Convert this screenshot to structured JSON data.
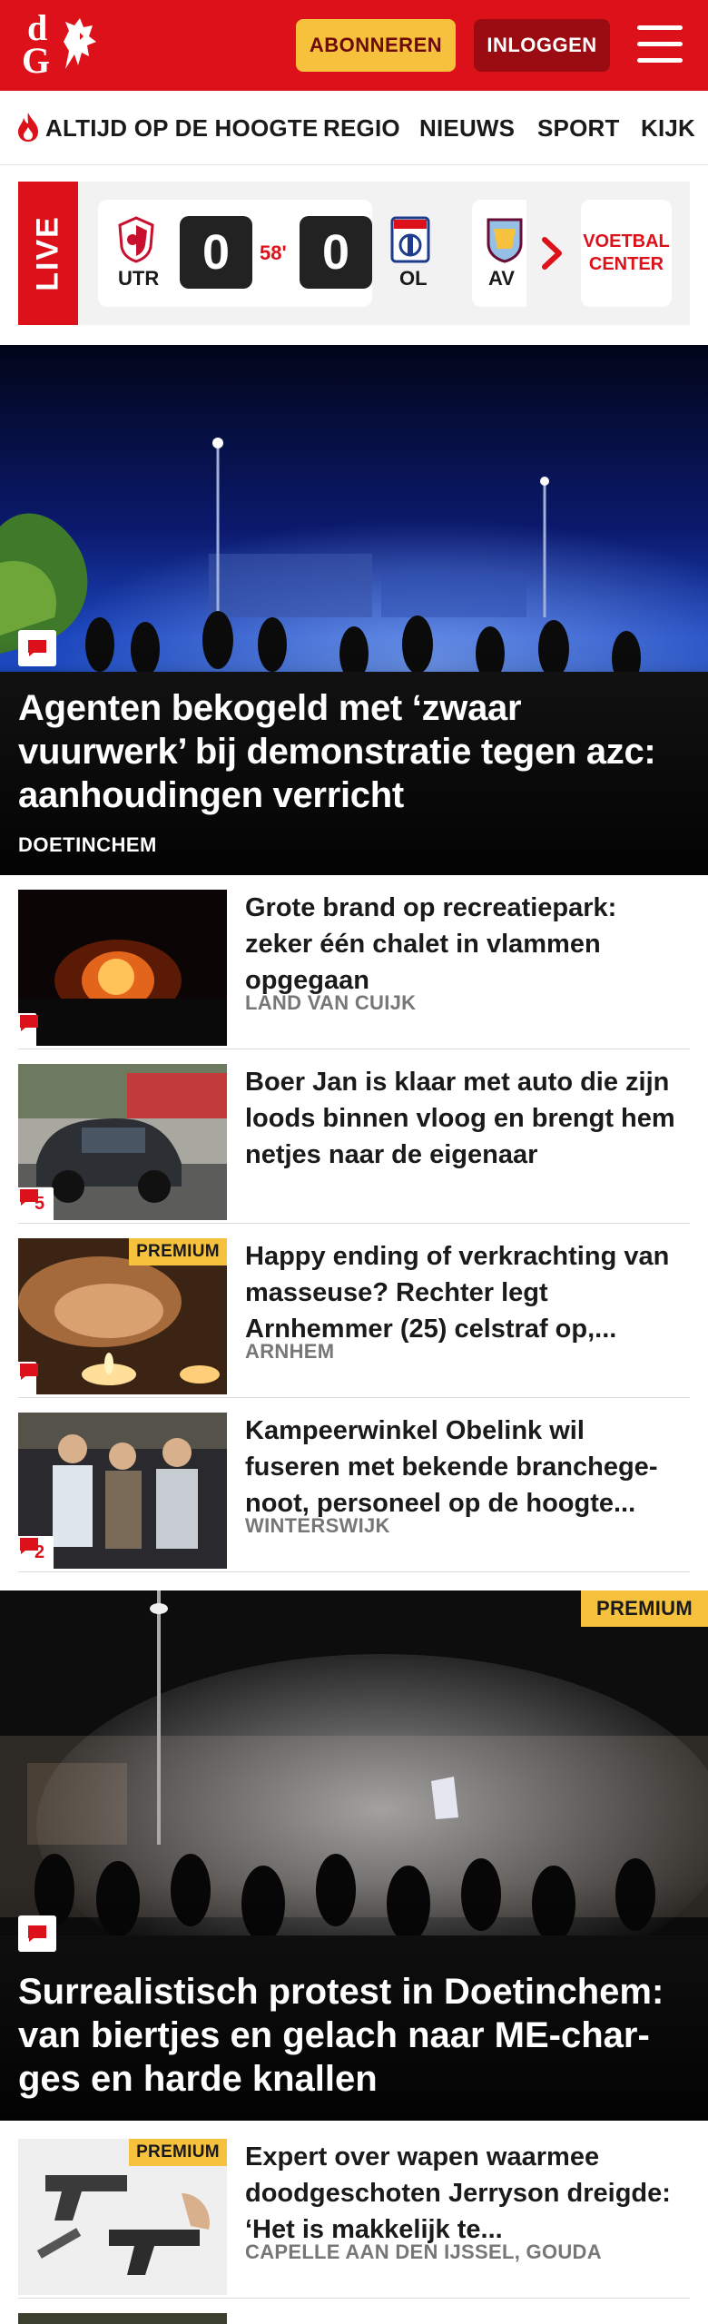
{
  "header": {
    "logo_line1": "d",
    "logo_line2": "G",
    "subscribe_label": "ABONNEREN",
    "login_label": "INLOGGEN"
  },
  "nav": {
    "items": [
      "ALTIJD OP DE HOOGTE",
      "REGIO",
      "NIEUWS",
      "SPORT",
      "KIJK"
    ]
  },
  "live": {
    "tag": "LIVE",
    "match": {
      "home_code": "UTR",
      "away_code": "OL",
      "home_score": "0",
      "away_score": "0",
      "minute": "58'"
    },
    "next_match_code": "AV",
    "voetbal_center": "VOETBAL CENTER"
  },
  "hero": {
    "title": "Agenten bekogeld met ‘zwaar vuurwerk’ bij demonstratie tegen azc: aanhoudingen verricht",
    "location": "DOETINCHEM"
  },
  "articles": [
    {
      "title": "Grote brand op recreatiepark: zeker één chalet in vlammen opgegaan",
      "location": "LAND VAN CUIJK",
      "comments": "",
      "premium": ""
    },
    {
      "title": "Boer Jan is klaar met auto die zijn loods binnen vloog en brengt hem netjes naar de eigenaar",
      "location": "",
      "comments": "5",
      "premium": ""
    },
    {
      "title": "Happy ending of verkrachting van masseuse? Rechter legt Arnhemmer (25) celstraf op,...",
      "location": "ARNHEM",
      "comments": "",
      "premium": "PREMIUM"
    },
    {
      "title": "Kampeerwinkel Obelink wil fuseren met bekende branchege­noot, personeel op de hoogte...",
      "location": "WINTERSWIJK",
      "comments": "2",
      "premium": ""
    }
  ],
  "hero2": {
    "title": "Surrealistisch protest in Doetinchem: van biertjes en gelach naar ME-char­ges en harde knallen",
    "premium": "PREMIUM"
  },
  "article5": {
    "title": "Expert over wapen waarmee doodgeschoten Jerryson dreigde: ‘Het is makkelijk te...",
    "location": "CAPELLE AAN DEN IJSSEL, GOUDA",
    "premium": "PREMIUM"
  },
  "colors": {
    "brand_red": "#dc111a",
    "premium_yellow": "#f6c23d",
    "login_dark_red": "#9b0c12"
  }
}
